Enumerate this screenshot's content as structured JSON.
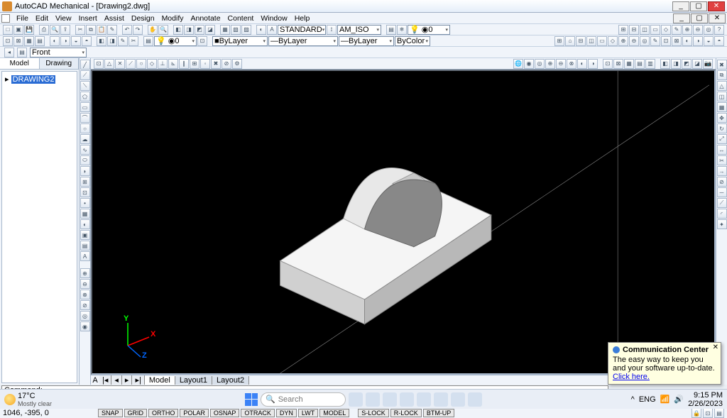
{
  "title": "AutoCAD Mechanical - [Drawing2.dwg]",
  "menu": [
    "File",
    "Edit",
    "View",
    "Insert",
    "Assist",
    "Design",
    "Modify",
    "Annotate",
    "Content",
    "Window",
    "Help"
  ],
  "styles": {
    "textStyle": "STANDARD",
    "dimStyle": "AM_ISO"
  },
  "layer": {
    "current": "0",
    "color": "ByLayer",
    "linetype": "ByLayer",
    "lineweight": "ByLayer",
    "plotStyle": "ByColor"
  },
  "view": {
    "selected": "Front"
  },
  "tree": {
    "tabs": [
      "Model",
      "Drawing"
    ],
    "active": "Model",
    "items": [
      "DRAWING2"
    ]
  },
  "bottomTabs": {
    "active": "Model",
    "tabs": [
      "Model",
      "Layout1",
      "Layout2"
    ]
  },
  "command": {
    "lines": [
      "Command:",
      "Command:",
      "Command:"
    ]
  },
  "status": {
    "coords": "1046, -395, 0",
    "toggles": [
      "SNAP",
      "GRID",
      "ORTHO",
      "POLAR",
      "OSNAP",
      "OTRACK",
      "DYN",
      "LWT",
      "MODEL"
    ],
    "locks": [
      "S-LOCK",
      "R-LOCK",
      "BTM-UP"
    ]
  },
  "popup": {
    "title": "Communication Center",
    "body": "The easy way to keep you and your software up-to-date.",
    "link": "Click here."
  },
  "ucs": {
    "x": "X",
    "y": "Y",
    "z": "Z"
  },
  "taskbar": {
    "temp": "17°C",
    "cond": "Mostly clear",
    "search": "Search",
    "tray": {
      "dir": "^",
      "lang": "ENG",
      "time": "9:15 PM",
      "date": "2/26/2023"
    }
  }
}
